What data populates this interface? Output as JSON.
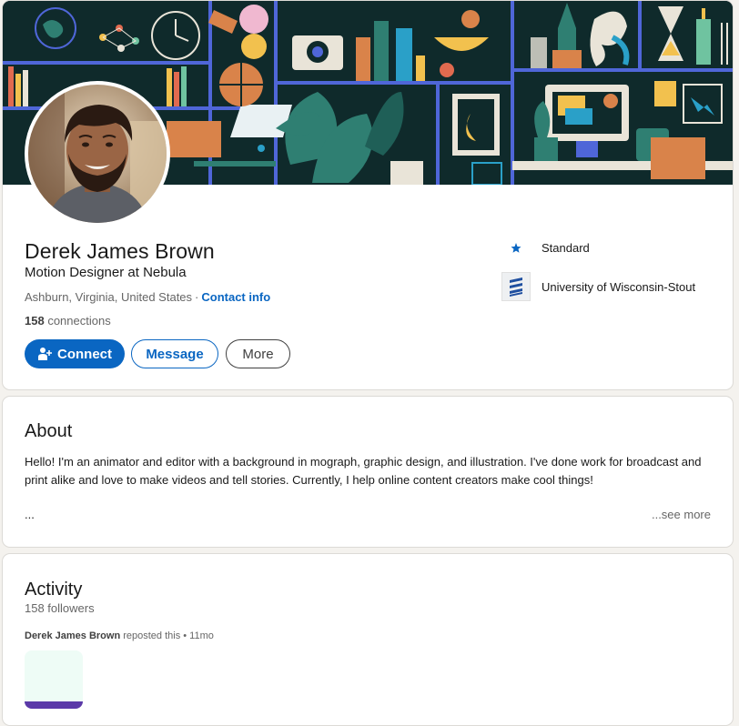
{
  "profile": {
    "name": "Derek James Brown",
    "headline": "Motion Designer at Nebula",
    "location": "Ashburn, Virginia, United States",
    "separator": "·",
    "contact_info": "Contact info",
    "connections_count": "158",
    "connections_label": "connections"
  },
  "actions": {
    "connect": "Connect",
    "message": "Message",
    "more": "More"
  },
  "side": {
    "standard": "Standard",
    "university": "University of Wisconsin-Stout"
  },
  "about": {
    "title": "About",
    "text": "Hello! I'm an animator and editor with a background in mograph, graphic design, and illustration. I've done work for broadcast and print alike and love to make videos and tell stories. Currently, I help online content creators make cool things!",
    "ellipsis": "...",
    "see_more": "...see more"
  },
  "activity": {
    "title": "Activity",
    "followers": "158 followers",
    "repost_author": "Derek James Brown",
    "repost_text": "reposted this • 11mo"
  },
  "colors": {
    "brand_blue": "#0a66c2",
    "background": "#f4f2ee",
    "banner_bg": "#0f2a2b",
    "banner_shelf": "#4f66d8"
  },
  "icons": {
    "connect": "person-add-icon",
    "standard": "star-icon",
    "university": "university-logo"
  }
}
